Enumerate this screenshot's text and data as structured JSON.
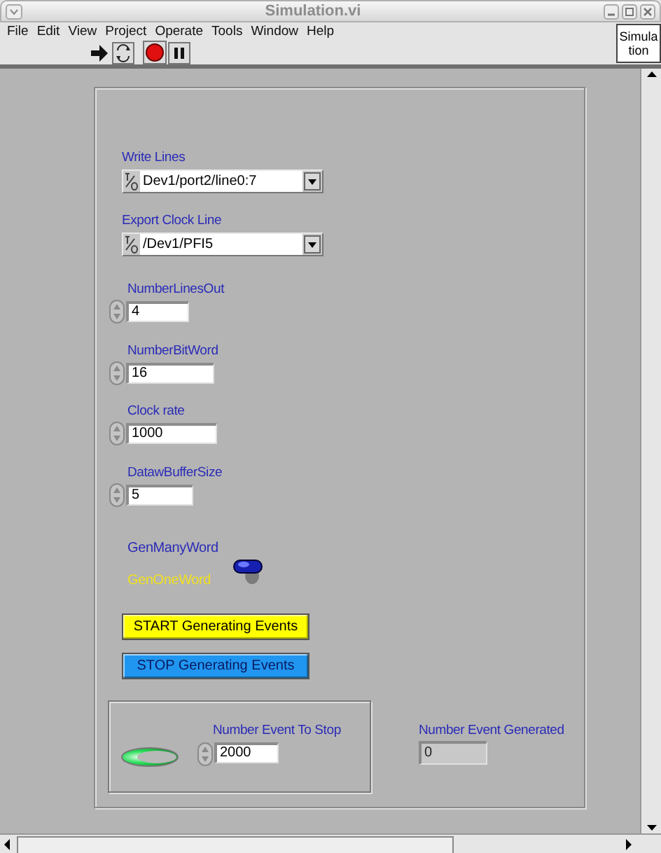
{
  "window": {
    "title": "Simulation.vi"
  },
  "menu": [
    "File",
    "Edit",
    "View",
    "Project",
    "Operate",
    "Tools",
    "Window",
    "Help"
  ],
  "vi_icon": [
    "Simula",
    "tion"
  ],
  "controls": [
    {
      "kind": "ring",
      "label": "Write Lines",
      "value": "Dev1/port2/line0:7"
    },
    {
      "kind": "ring",
      "label": "Export Clock Line",
      "value": "/Dev1/PFI5"
    },
    {
      "kind": "numeric",
      "label": "NumberLinesOut",
      "value": "4"
    },
    {
      "kind": "numeric",
      "label": "NumberBitWord",
      "value": "16"
    },
    {
      "kind": "numeric",
      "label": "Clock rate",
      "value": "1000"
    },
    {
      "kind": "numeric",
      "label": "DatawBufferSize",
      "value": "5"
    },
    {
      "kind": "toggle",
      "on": true,
      "labels": [
        {
          "text": "GenManyWord",
          "highlighted": false
        },
        {
          "text": "GenOneWord",
          "highlighted": true
        }
      ]
    },
    {
      "kind": "button",
      "label": "START Generating Events",
      "color": "#ffff00"
    },
    {
      "kind": "button",
      "label": "STOP Generating Events",
      "color": "#2196f0"
    },
    {
      "kind": "group",
      "led_on": true,
      "label": "Number Event To Stop",
      "value": "2000"
    },
    {
      "kind": "indicator",
      "label": "Number Event Generated",
      "value": "0"
    }
  ]
}
